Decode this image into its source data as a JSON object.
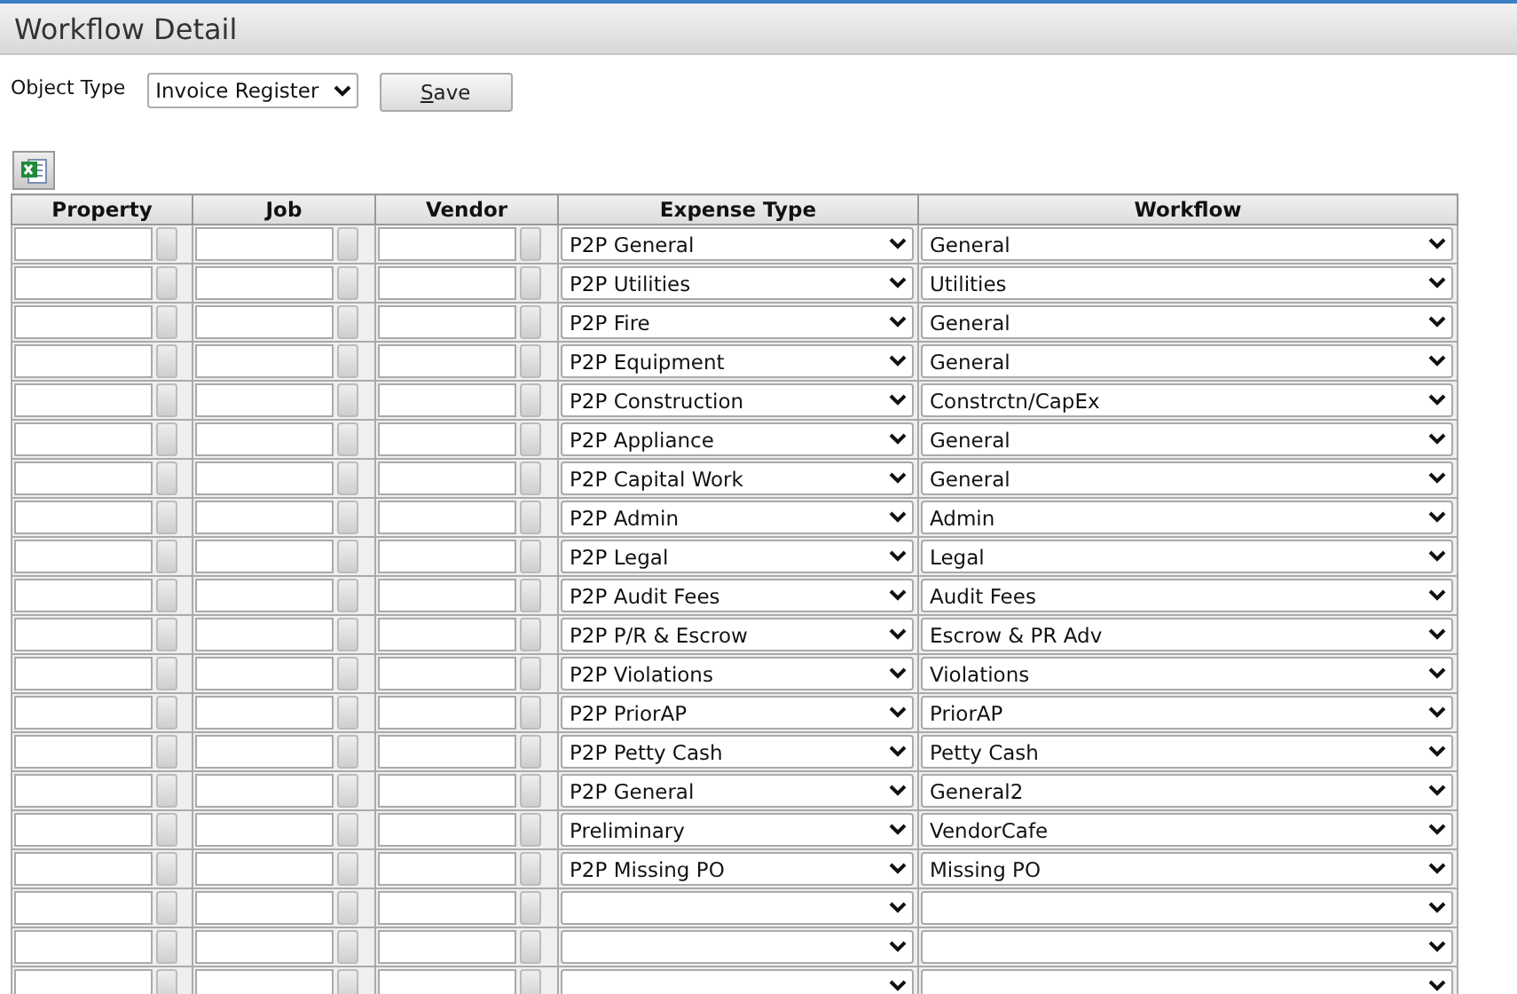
{
  "page": {
    "title": "Workflow Detail"
  },
  "filter": {
    "label": "Object Type",
    "value": "Invoice Register",
    "save_button": "Save"
  },
  "table": {
    "columns": [
      "Property",
      "Job",
      "Vendor",
      "Expense Type",
      "Workflow"
    ],
    "rows": [
      {
        "expense_type": "P2P General",
        "workflow": "General"
      },
      {
        "expense_type": "P2P Utilities",
        "workflow": "Utilities"
      },
      {
        "expense_type": "P2P Fire",
        "workflow": "General"
      },
      {
        "expense_type": "P2P Equipment",
        "workflow": "General"
      },
      {
        "expense_type": "P2P Construction",
        "workflow": "Constrctn/CapEx"
      },
      {
        "expense_type": "P2P Appliance",
        "workflow": "General"
      },
      {
        "expense_type": "P2P Capital Work",
        "workflow": "General"
      },
      {
        "expense_type": "P2P Admin",
        "workflow": "Admin"
      },
      {
        "expense_type": "P2P Legal",
        "workflow": "Legal"
      },
      {
        "expense_type": "P2P Audit Fees",
        "workflow": "Audit Fees"
      },
      {
        "expense_type": "P2P P/R & Escrow",
        "workflow": "Escrow & PR Adv"
      },
      {
        "expense_type": "P2P Violations",
        "workflow": "Violations"
      },
      {
        "expense_type": "P2P PriorAP",
        "workflow": "PriorAP"
      },
      {
        "expense_type": "P2P Petty Cash",
        "workflow": "Petty Cash"
      },
      {
        "expense_type": "P2P General",
        "workflow": "General2"
      },
      {
        "expense_type": "Preliminary",
        "workflow": "VendorCafe"
      },
      {
        "expense_type": "P2P Missing PO",
        "workflow": "Missing PO"
      },
      {},
      {},
      {}
    ]
  }
}
